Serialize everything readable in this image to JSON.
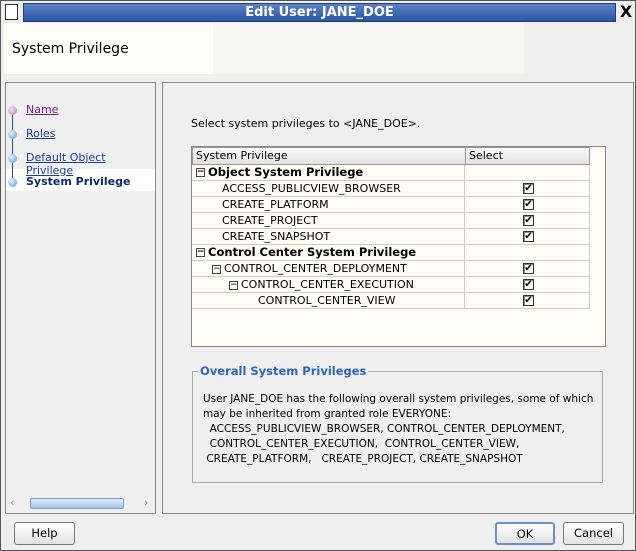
{
  "window": {
    "title": "Edit User: JANE_DOE",
    "close_glyph": "X"
  },
  "header": {
    "title": "System Privilege"
  },
  "steps": [
    {
      "label": "Name",
      "state": "visited"
    },
    {
      "label": "Roles",
      "state": "link"
    },
    {
      "label": "Default Object Privilege",
      "state": "link"
    },
    {
      "label": "System Privilege",
      "state": "current"
    }
  ],
  "main": {
    "prompt": "Select system privileges to <JANE_DOE>.",
    "table": {
      "columns": [
        "System Privilege",
        "Select"
      ],
      "rows": [
        {
          "label": "Object System Privilege",
          "group": true,
          "expander": "⊟",
          "indent": 0,
          "checked": null
        },
        {
          "label": "ACCESS_PUBLICVIEW_BROWSER",
          "indent": 1,
          "checked": true
        },
        {
          "label": "CREATE_PLATFORM",
          "indent": 1,
          "checked": true
        },
        {
          "label": "CREATE_PROJECT",
          "indent": 1,
          "checked": true
        },
        {
          "label": "CREATE_SNAPSHOT",
          "indent": 1,
          "checked": true
        },
        {
          "label": "Control Center System Privilege",
          "group": true,
          "expander": "⊟",
          "indent": 0,
          "checked": null
        },
        {
          "label": "CONTROL_CENTER_DEPLOYMENT",
          "expander": "⊟",
          "indent": 1,
          "checked": true
        },
        {
          "label": "CONTROL_CENTER_EXECUTION",
          "expander": "⊟",
          "indent": 2,
          "checked": true
        },
        {
          "label": "CONTROL_CENTER_VIEW",
          "indent": 3,
          "checked": true
        }
      ]
    },
    "overall": {
      "title": "Overall System Privileges",
      "lines": [
        "User JANE_DOE has the following overall system privileges, some of which",
        "may be inherited from granted role EVERYONE:",
        "  ACCESS_PUBLICVIEW_BROWSER, CONTROL_CENTER_DEPLOYMENT,",
        "  CONTROL_CENTER_EXECUTION,  CONTROL_CENTER_VIEW,",
        " CREATE_PLATFORM,   CREATE_PROJECT, CREATE_SNAPSHOT"
      ]
    }
  },
  "buttons": {
    "help": "Help",
    "ok": "OK",
    "cancel": "Cancel"
  },
  "colors": {
    "title_bar": "#2d56a4",
    "link": "#1a3d9c",
    "visited_link": "#7a1f87",
    "legend": "#2e63b8"
  }
}
